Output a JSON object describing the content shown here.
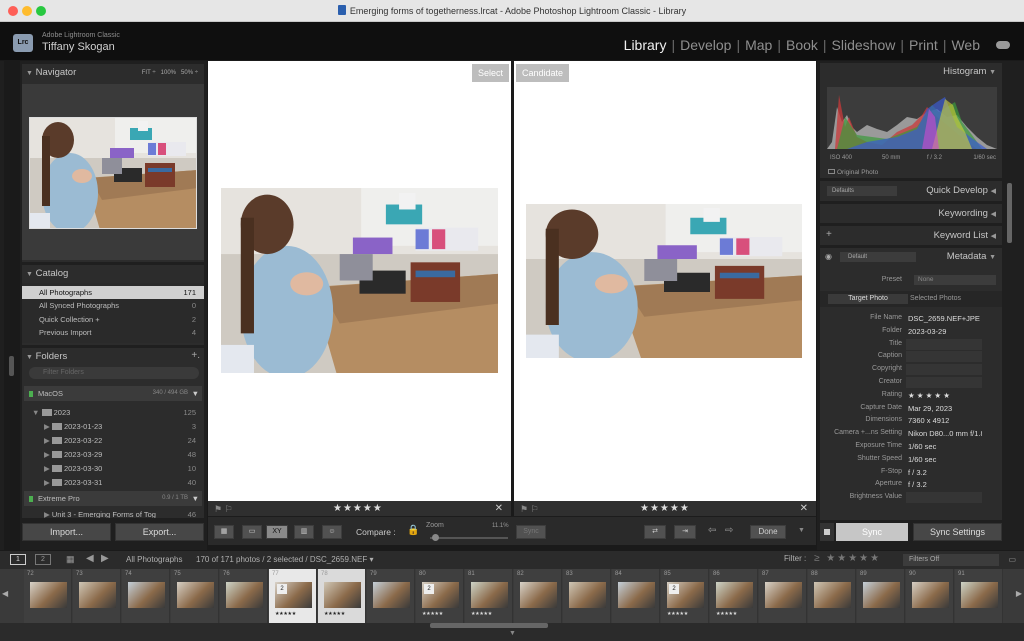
{
  "window": {
    "title": "Emerging forms of togetherness.lrcat - Adobe Photoshop Lightroom Classic - Library"
  },
  "identity": {
    "app": "Adobe Lightroom Classic",
    "user": "Tiffany Skogan",
    "logo": "Lrc"
  },
  "modules": [
    "Library",
    "Develop",
    "Map",
    "Book",
    "Slideshow",
    "Print",
    "Web"
  ],
  "navigator": {
    "title": "Navigator",
    "zoom": [
      "FIT",
      "100%",
      "50%"
    ]
  },
  "catalog": {
    "title": "Catalog",
    "items": [
      {
        "label": "All Photographs",
        "count": "171"
      },
      {
        "label": "All Synced Photographs",
        "count": "0"
      },
      {
        "label": "Quick Collection +",
        "count": "2"
      },
      {
        "label": "Previous Import",
        "count": "4"
      }
    ]
  },
  "folders": {
    "title": "Folders",
    "filter_placeholder": "Filter Folders",
    "volume1": {
      "name": "MacOS",
      "size": "340 / 494 GB"
    },
    "year": {
      "name": "2023",
      "count": "125"
    },
    "items": [
      {
        "name": "2023-01-23",
        "count": "3"
      },
      {
        "name": "2023-03-22",
        "count": "24"
      },
      {
        "name": "2023-03-29",
        "count": "48"
      },
      {
        "name": "2023-03-30",
        "count": "10"
      },
      {
        "name": "2023-03-31",
        "count": "40"
      }
    ],
    "volume2": {
      "name": "Extreme Pro",
      "size": "0.9 / 1 TB"
    },
    "collection": {
      "name": "Unit 3 - Emerging Forms of Tog",
      "count": "46"
    }
  },
  "left_buttons": {
    "import": "Import...",
    "export": "Export..."
  },
  "compare": {
    "select_label": "Select",
    "candidate_label": "Candidate",
    "stars": "★★★★★"
  },
  "toolbar": {
    "compare_label": "Compare :",
    "zoom_label": "Zoom",
    "zoom_value": "11.1%",
    "sync": "Sync",
    "done": "Done",
    "xy": "XY"
  },
  "histogram": {
    "title": "Histogram",
    "iso": "ISO 400",
    "focal": "50 mm",
    "fstop": "f / 3.2",
    "shutter": "1/60 sec",
    "original": "Original Photo"
  },
  "quick_develop": {
    "title": "Quick Develop",
    "preset": "Defaults"
  },
  "keywording": {
    "title": "Keywording"
  },
  "keyword_list": {
    "title": "Keyword List"
  },
  "metadata": {
    "title": "Metadata",
    "preset_select": "Default",
    "preset_label": "Preset",
    "preset_value": "None",
    "tab_target": "Target Photo",
    "tab_selected": "Selected Photos",
    "fields": [
      {
        "label": "File Name",
        "value": "DSC_2659.NEF+JPE"
      },
      {
        "label": "Folder",
        "value": "2023-03-29"
      },
      {
        "label": "Title",
        "value": ""
      },
      {
        "label": "Caption",
        "value": ""
      },
      {
        "label": "Copyright",
        "value": ""
      },
      {
        "label": "Creator",
        "value": ""
      },
      {
        "label": "Rating",
        "value": "★ ★ ★ ★ ★"
      },
      {
        "label": "Capture Date",
        "value": "Mar 29, 2023"
      },
      {
        "label": "Dimensions",
        "value": "7360 x 4912"
      },
      {
        "label": "Camera +...ns Setting",
        "value": "Nikon D80...0 mm f/1.8)"
      },
      {
        "label": "Exposure Time",
        "value": "1/60 sec"
      },
      {
        "label": "Shutter Speed",
        "value": "1/60 sec"
      },
      {
        "label": "F-Stop",
        "value": "f / 3.2"
      },
      {
        "label": "Aperture",
        "value": "f / 3.2"
      },
      {
        "label": "Brightness Value",
        "value": ""
      }
    ]
  },
  "right_buttons": {
    "sync": "Sync",
    "sync_settings": "Sync Settings"
  },
  "filmstrip_bar": {
    "page1": "1",
    "page2": "2",
    "source": "All Photographs",
    "status": "170 of 171 photos / 2 selected / DSC_2659.NEF ▾",
    "filter": "Filter :",
    "filter_state": "Filters Off"
  },
  "filmstrip": [
    {
      "n": "72"
    },
    {
      "n": "73"
    },
    {
      "n": "74"
    },
    {
      "n": "75"
    },
    {
      "n": "76"
    },
    {
      "n": "77",
      "stars": "★★★★★",
      "badge": "2"
    },
    {
      "n": "78",
      "stars": "★★★★★"
    },
    {
      "n": "79"
    },
    {
      "n": "80",
      "badge": "2",
      "stars": "★★★★★"
    },
    {
      "n": "81",
      "stars": "★★★★★"
    },
    {
      "n": "82"
    },
    {
      "n": "83"
    },
    {
      "n": "84"
    },
    {
      "n": "85",
      "badge": "2",
      "stars": "★★★★★"
    },
    {
      "n": "86",
      "stars": "★★★★★"
    },
    {
      "n": "87"
    },
    {
      "n": "88"
    },
    {
      "n": "89"
    },
    {
      "n": "90"
    },
    {
      "n": "91"
    }
  ]
}
